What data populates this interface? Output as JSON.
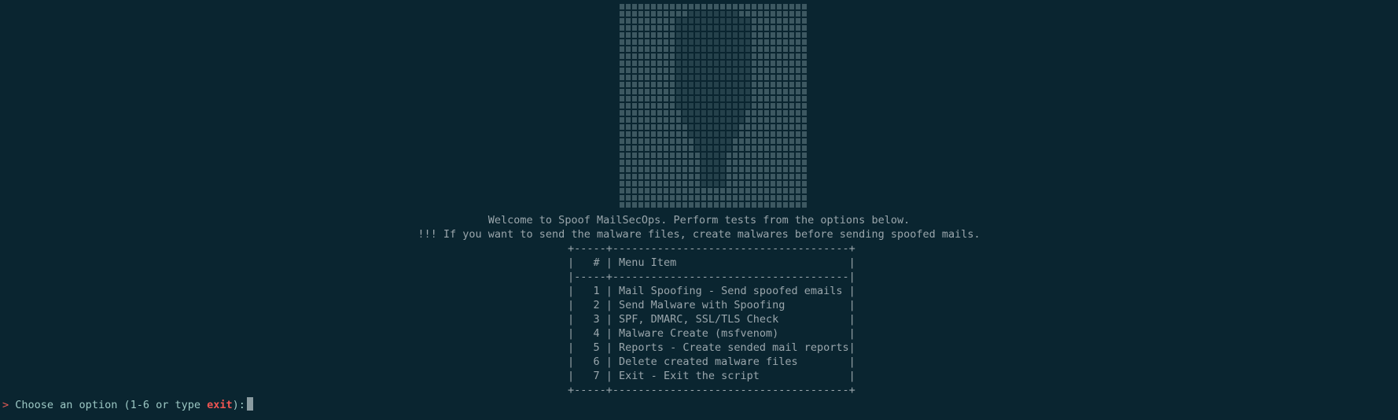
{
  "terminal": {
    "background": "#0a2530",
    "text_color": "#9aa6ac",
    "welcome": "Welcome to Spoof MailSecOps. Perform tests from the options below.",
    "warning": "!!! If you want to send the malware files, create malwares before sending spoofed mails."
  },
  "menu": {
    "header_number": "#",
    "header_label": "Menu Item",
    "items": [
      {
        "number": "1",
        "label": "Mail Spoofing - Send spoofed emails"
      },
      {
        "number": "2",
        "label": "Send Malware with Spoofing"
      },
      {
        "number": "3",
        "label": "SPF, DMARC, SSL/TLS Check"
      },
      {
        "number": "4",
        "label": "Malware Create (msfvenom)"
      },
      {
        "number": "5",
        "label": "Reports - Create sended mail reports"
      },
      {
        "number": "6",
        "label": "Delete created malware files"
      },
      {
        "number": "7",
        "label": "Exit - Exit the script"
      }
    ]
  },
  "prompt": {
    "caret": ">",
    "text": "Choose an option (1-6 or type ",
    "keyword": "exit",
    "suffix": "):",
    "caret_color": "#e05a55",
    "keyword_color": "#ef5552"
  },
  "logo": {
    "icon": "ascii-art-block-logo"
  }
}
